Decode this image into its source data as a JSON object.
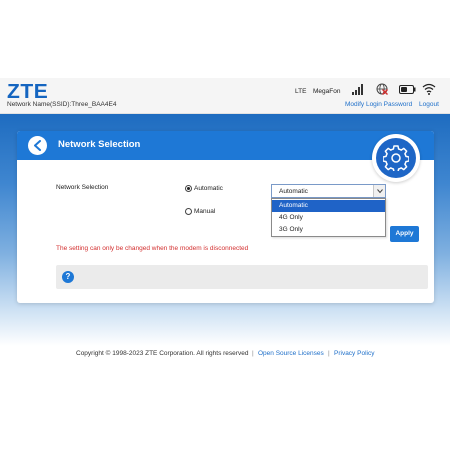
{
  "header": {
    "logo": "ZTE",
    "ssid_text": "Network Name(SSID):Three_BAA4E4",
    "network_type": "LTE",
    "carrier": "MegaFon",
    "modify_password_label": "Modify Login Password",
    "logout_label": "Logout",
    "icons": [
      "signal-icon",
      "globe-icon",
      "battery-icon",
      "wifi-icon"
    ]
  },
  "panel": {
    "title": "Network Selection",
    "field_label": "Network Selection",
    "radio_options": [
      {
        "label": "Automatic",
        "checked": true
      },
      {
        "label": "Manual",
        "checked": false
      }
    ],
    "select": {
      "value": "Automatic",
      "options": [
        "Automatic",
        "4G Only",
        "3G Only"
      ],
      "highlighted_index": 0
    },
    "apply_label": "Apply",
    "warning": "The setting can only be changed when the modem is disconnected",
    "help_icon": "?"
  },
  "footer": {
    "copyright": "Copyright © 1998-2023 ZTE Corporation. All rights reserved",
    "separator": "|",
    "open_source_label": "Open Source Licenses",
    "privacy_label": "Privacy Policy"
  },
  "colors": {
    "brand_blue": "#1e78d6",
    "link_blue": "#1e6fc9",
    "warning_red": "#d32f2f",
    "highlight_blue": "#1f63c7"
  }
}
